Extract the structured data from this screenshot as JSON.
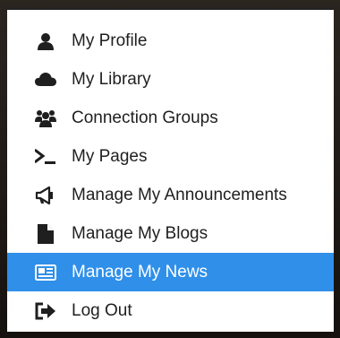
{
  "menu": {
    "items": [
      {
        "label": "My Profile",
        "icon": "user-icon",
        "active": false
      },
      {
        "label": "My Library",
        "icon": "cloud-icon",
        "active": false
      },
      {
        "label": "Connection Groups",
        "icon": "users-icon",
        "active": false
      },
      {
        "label": "My Pages",
        "icon": "terminal-icon",
        "active": false
      },
      {
        "label": "Manage My Announcements",
        "icon": "bullhorn-icon",
        "active": false
      },
      {
        "label": "Manage My Blogs",
        "icon": "file-icon",
        "active": false
      },
      {
        "label": "Manage My News",
        "icon": "newspaper-icon",
        "active": true
      },
      {
        "label": "Log Out",
        "icon": "sign-out-icon",
        "active": false
      }
    ],
    "colors": {
      "active_bg": "#2f8fe9",
      "active_text": "#ffffff",
      "text": "#1f1f1f",
      "icon": "#1f1f1f"
    }
  }
}
